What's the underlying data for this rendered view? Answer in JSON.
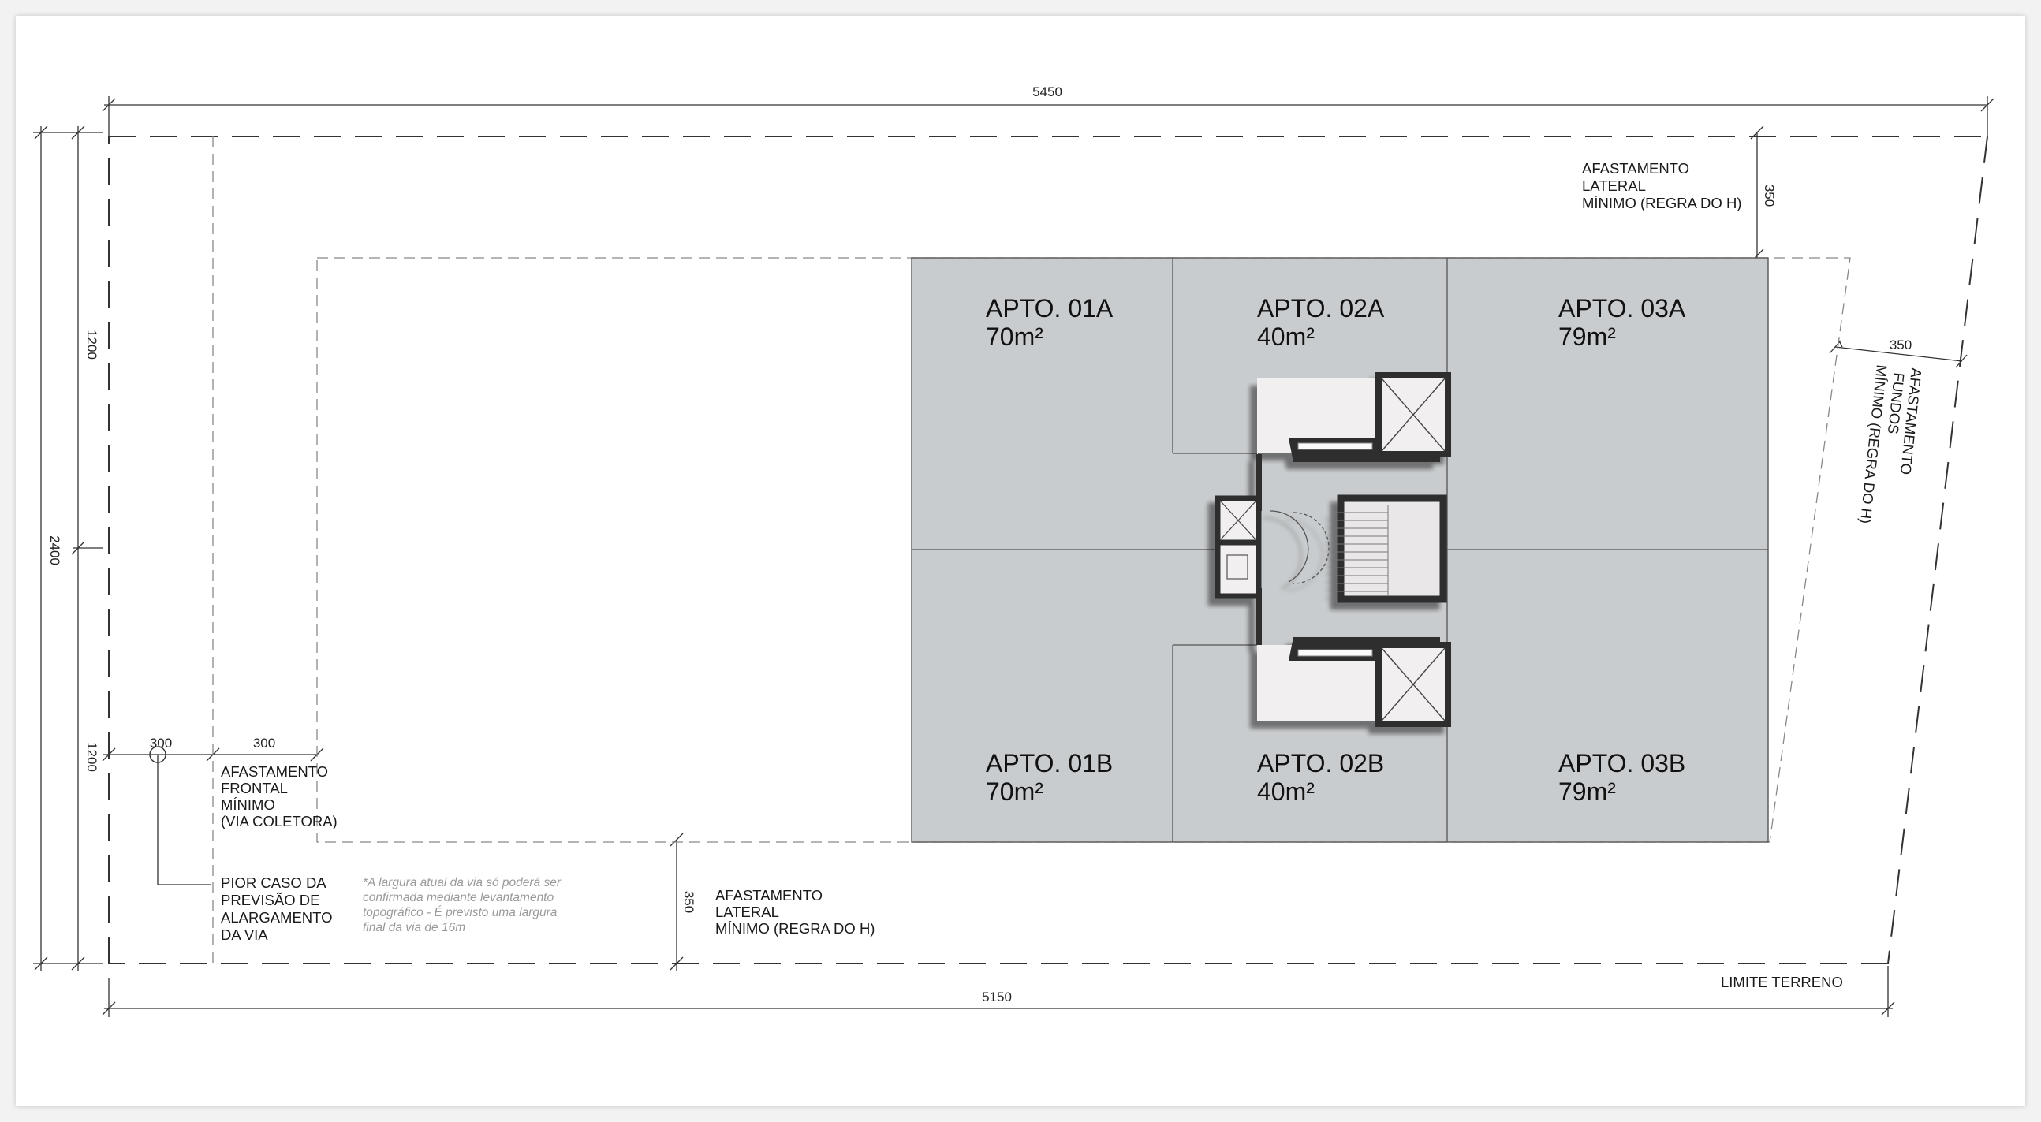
{
  "dimensions": {
    "top": "5450",
    "bottom": "5150",
    "left_total": "2400",
    "left_upper": "1200",
    "left_lower": "1200",
    "setback_top": "350",
    "setback_right": "350",
    "setback_bottom": "350",
    "front_a": "300",
    "front_b": "300"
  },
  "labels": {
    "lateral_top": [
      "AFASTAMENTO",
      "LATERAL",
      "MÍNIMO (REGRA DO H)"
    ],
    "fundos": [
      "AFASTAMENTO",
      "FUNDOS",
      "MÍNIMO (REGRA DO H)"
    ],
    "frontal": [
      "AFASTAMENTO",
      "FRONTAL",
      "MÍNIMO",
      "(VIA COLETORA)"
    ],
    "pior_caso": [
      "PIOR CASO DA",
      "PREVISÃO DE",
      "ALARGAMENTO",
      "DA VIA"
    ],
    "footnote": [
      "*A largura atual da via só poderá ser",
      "confirmada mediante levantamento",
      "topográfico - É previsto uma largura",
      "final da via de 16m"
    ],
    "lateral_bottom": [
      "AFASTAMENTO",
      "LATERAL",
      "MÍNIMO (REGRA DO H)"
    ],
    "limite": "LIMITE TERRENO"
  },
  "apartments": [
    {
      "name": "APTO. 01A",
      "area": "70m²"
    },
    {
      "name": "APTO. 02A",
      "area": "40m²"
    },
    {
      "name": "APTO. 03A",
      "area": "79m²"
    },
    {
      "name": "APTO. 01B",
      "area": "70m²"
    },
    {
      "name": "APTO. 02B",
      "area": "40m²"
    },
    {
      "name": "APTO. 03B",
      "area": "79m²"
    }
  ],
  "colors": {
    "apartment_fill": "#c9ccce",
    "core_floor": "#f1efef",
    "wall": "#2e2e2e",
    "line": "#555555"
  }
}
